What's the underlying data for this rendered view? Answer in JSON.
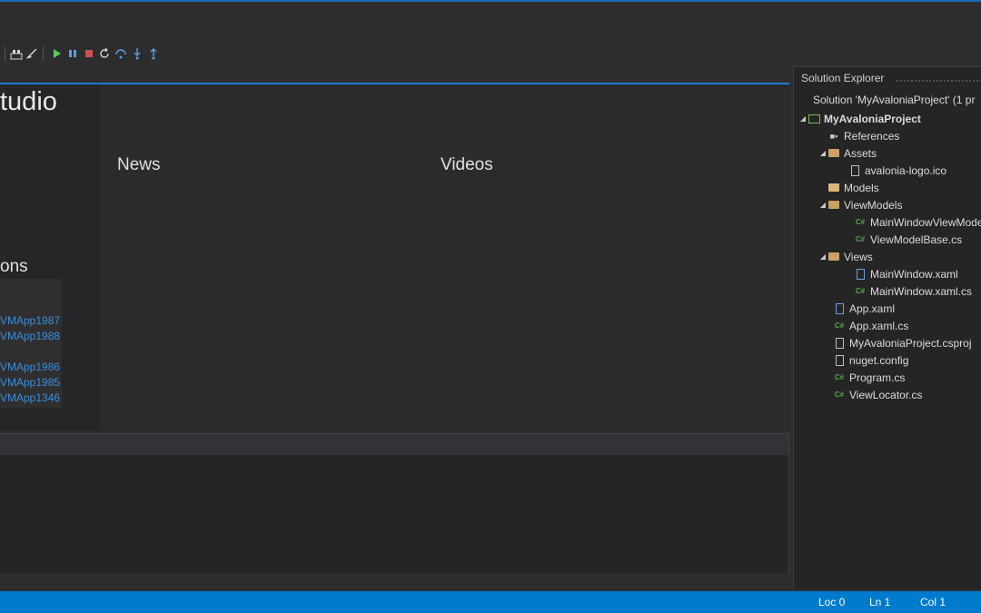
{
  "toolbar": {
    "icons": [
      "build-icon",
      "clean-icon",
      "start-icon",
      "pause-icon",
      "stop-icon",
      "restart-icon",
      "step-over-icon",
      "step-into-icon",
      "step-out-icon"
    ]
  },
  "start_page": {
    "brand": "tudio",
    "recent_heading": "ons",
    "recent_items": [
      "VMApp1987",
      "VMApp1988",
      "VMApp1986",
      "VMApp1985",
      "VMApp1346"
    ],
    "news_heading": "News",
    "videos_heading": "Videos"
  },
  "solution_explorer": {
    "title": "Solution Explorer",
    "solution_label": "Solution 'MyAvaloniaProject' (1 pr",
    "items": [
      {
        "label": "MyAvaloniaProject",
        "icon": "project-icon"
      },
      {
        "label": "References",
        "icon": "references-icon"
      },
      {
        "label": "Assets",
        "icon": "folder-open-icon"
      },
      {
        "label": "avalonia-logo.ico",
        "icon": "file-icon"
      },
      {
        "label": "Models",
        "icon": "folder-icon"
      },
      {
        "label": "ViewModels",
        "icon": "folder-open-icon"
      },
      {
        "label": "MainWindowViewMode",
        "icon": "csharp-file-icon"
      },
      {
        "label": "ViewModelBase.cs",
        "icon": "csharp-file-icon"
      },
      {
        "label": "Views",
        "icon": "folder-open-icon"
      },
      {
        "label": "MainWindow.xaml",
        "icon": "xaml-file-icon"
      },
      {
        "label": "MainWindow.xaml.cs",
        "icon": "csharp-file-icon"
      },
      {
        "label": "App.xaml",
        "icon": "xaml-file-icon"
      },
      {
        "label": "App.xaml.cs",
        "icon": "csharp-file-icon"
      },
      {
        "label": "MyAvaloniaProject.csproj",
        "icon": "file-icon"
      },
      {
        "label": "nuget.config",
        "icon": "file-icon"
      },
      {
        "label": "Program.cs",
        "icon": "csharp-file-icon"
      },
      {
        "label": "ViewLocator.cs",
        "icon": "csharp-file-icon"
      }
    ]
  },
  "status_bar": {
    "loc": "Loc 0",
    "ln": "Ln 1",
    "col": "Col 1"
  },
  "colors": {
    "accent": "#007acc",
    "link": "#3b8ed8",
    "background": "#2d2d30"
  }
}
